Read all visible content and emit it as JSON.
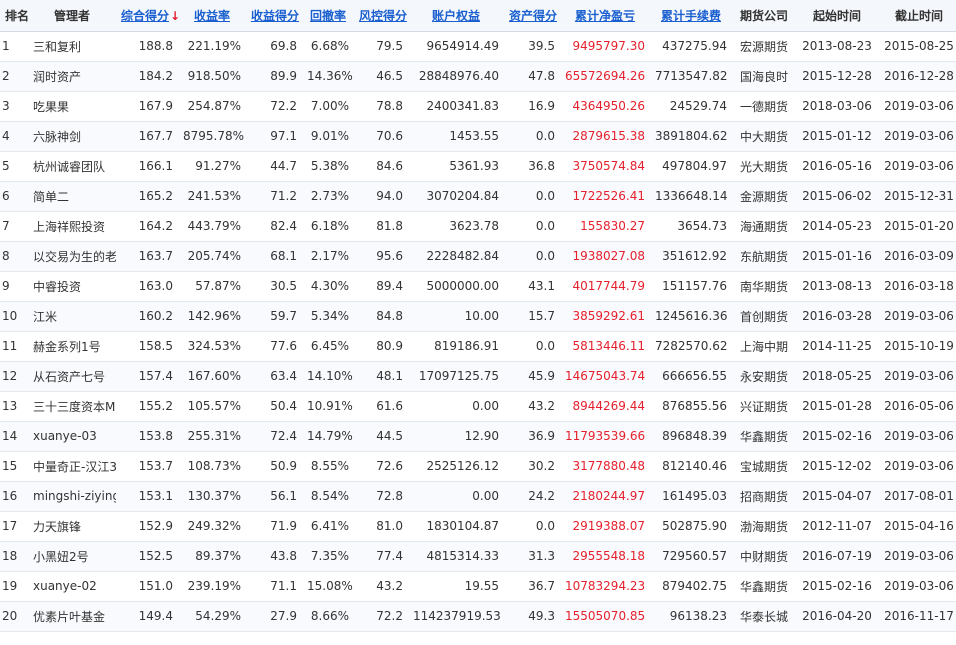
{
  "columns": [
    {
      "key": "rank",
      "label": "排名",
      "sortable": false
    },
    {
      "key": "manager",
      "label": "管理者",
      "sortable": false
    },
    {
      "key": "score",
      "label": "综合得分",
      "sortable": true,
      "sort_indicator": "↓"
    },
    {
      "key": "return_rate",
      "label": "收益率",
      "sortable": true
    },
    {
      "key": "return_score",
      "label": "收益得分",
      "sortable": true
    },
    {
      "key": "drawdown",
      "label": "回撤率",
      "sortable": true
    },
    {
      "key": "risk_score",
      "label": "风控得分",
      "sortable": true
    },
    {
      "key": "equity",
      "label": "账户权益",
      "sortable": true
    },
    {
      "key": "asset_score",
      "label": "资产得分",
      "sortable": true
    },
    {
      "key": "net_profit",
      "label": "累计净盈亏",
      "sortable": true
    },
    {
      "key": "fees",
      "label": "累计手续费",
      "sortable": true
    },
    {
      "key": "futures_co",
      "label": "期货公司",
      "sortable": false
    },
    {
      "key": "start",
      "label": "起始时间",
      "sortable": false
    },
    {
      "key": "end",
      "label": "截止时间",
      "sortable": false
    }
  ],
  "highlight_color": "#e5202d",
  "link_color": "#1a5fcf",
  "rows": [
    [
      "1",
      "三和复利",
      "188.8",
      "221.19%",
      "69.8",
      "6.68%",
      "79.5",
      "9654914.49",
      "39.5",
      "9495797.30",
      "437275.94",
      "宏源期货",
      "2013-08-23",
      "2015-08-25"
    ],
    [
      "2",
      "润时资产",
      "184.2",
      "918.50%",
      "89.9",
      "14.36%",
      "46.5",
      "28848976.40",
      "47.8",
      "65572694.26",
      "7713547.82",
      "国海良时",
      "2015-12-28",
      "2016-12-28"
    ],
    [
      "3",
      "吃果果",
      "167.9",
      "254.87%",
      "72.2",
      "7.00%",
      "78.8",
      "2400341.83",
      "16.9",
      "4364950.26",
      "24529.74",
      "一德期货",
      "2018-03-06",
      "2019-03-06"
    ],
    [
      "4",
      "六脉神剑",
      "167.7",
      "8795.78%",
      "97.1",
      "9.01%",
      "70.6",
      "1453.55",
      "0.0",
      "2879615.38",
      "3891804.62",
      "中大期货",
      "2015-01-12",
      "2019-03-06"
    ],
    [
      "5",
      "杭州诚睿团队",
      "166.1",
      "91.27%",
      "44.7",
      "5.38%",
      "84.6",
      "5361.93",
      "36.8",
      "3750574.84",
      "497804.97",
      "光大期货",
      "2016-05-16",
      "2019-03-06"
    ],
    [
      "6",
      "简单二",
      "165.2",
      "241.53%",
      "71.2",
      "2.73%",
      "94.0",
      "3070204.84",
      "0.0",
      "1722526.41",
      "1336648.14",
      "金源期货",
      "2015-06-02",
      "2015-12-31"
    ],
    [
      "7",
      "上海祥熙投资",
      "164.2",
      "443.79%",
      "82.4",
      "6.18%",
      "81.8",
      "3623.78",
      "0.0",
      "155830.27",
      "3654.73",
      "海通期货",
      "2014-05-23",
      "2015-01-20"
    ],
    [
      "8",
      "以交易为生的老",
      "163.7",
      "205.74%",
      "68.1",
      "2.17%",
      "95.6",
      "2228482.84",
      "0.0",
      "1938027.08",
      "351612.92",
      "东航期货",
      "2015-01-16",
      "2016-03-09"
    ],
    [
      "9",
      "中睿投资",
      "163.0",
      "57.87%",
      "30.5",
      "4.30%",
      "89.4",
      "5000000.00",
      "43.1",
      "4017744.79",
      "151157.76",
      "南华期货",
      "2013-08-13",
      "2016-03-18"
    ],
    [
      "10",
      "江米",
      "160.2",
      "142.96%",
      "59.7",
      "5.34%",
      "84.8",
      "10.00",
      "15.7",
      "3859292.61",
      "1245616.36",
      "首创期货",
      "2016-03-28",
      "2019-03-06"
    ],
    [
      "11",
      "赫金系列1号",
      "158.5",
      "324.53%",
      "77.6",
      "6.45%",
      "80.9",
      "819186.91",
      "0.0",
      "5813446.11",
      "7282570.62",
      "上海中期",
      "2014-11-25",
      "2015-10-19"
    ],
    [
      "12",
      "从石资产七号",
      "157.4",
      "167.60%",
      "63.4",
      "14.10%",
      "48.1",
      "17097125.75",
      "45.9",
      "14675043.74",
      "666656.55",
      "永安期货",
      "2018-05-25",
      "2019-03-06"
    ],
    [
      "13",
      "三十三度资本M",
      "155.2",
      "105.57%",
      "50.4",
      "10.91%",
      "61.6",
      "0.00",
      "43.2",
      "8944269.44",
      "876855.56",
      "兴证期货",
      "2015-01-28",
      "2016-05-06"
    ],
    [
      "14",
      "xuanye-03",
      "153.8",
      "255.31%",
      "72.4",
      "14.79%",
      "44.5",
      "12.90",
      "36.9",
      "11793539.66",
      "896848.39",
      "华鑫期货",
      "2015-02-16",
      "2019-03-06"
    ],
    [
      "15",
      "中量奇正-汉江3",
      "153.7",
      "108.73%",
      "50.9",
      "8.55%",
      "72.6",
      "2525126.12",
      "30.2",
      "3177880.48",
      "812140.46",
      "宝城期货",
      "2015-12-02",
      "2019-03-06"
    ],
    [
      "16",
      "mingshi-ziying",
      "153.1",
      "130.37%",
      "56.1",
      "8.54%",
      "72.8",
      "0.00",
      "24.2",
      "2180244.97",
      "161495.03",
      "招商期货",
      "2015-04-07",
      "2017-08-01"
    ],
    [
      "17",
      "力天旗锋",
      "152.9",
      "249.32%",
      "71.9",
      "6.41%",
      "81.0",
      "1830104.87",
      "0.0",
      "2919388.07",
      "502875.90",
      "渤海期货",
      "2012-11-07",
      "2015-04-16"
    ],
    [
      "18",
      "小黑妞2号",
      "152.5",
      "89.37%",
      "43.8",
      "7.35%",
      "77.4",
      "4815314.33",
      "31.3",
      "2955548.18",
      "729560.57",
      "中财期货",
      "2016-07-19",
      "2019-03-06"
    ],
    [
      "19",
      "xuanye-02",
      "151.0",
      "239.19%",
      "71.1",
      "15.08%",
      "43.2",
      "19.55",
      "36.7",
      "10783294.23",
      "879402.75",
      "华鑫期货",
      "2015-02-16",
      "2019-03-06"
    ],
    [
      "20",
      "优素片叶基金",
      "149.4",
      "54.29%",
      "27.9",
      "8.66%",
      "72.2",
      "114237919.53",
      "49.3",
      "15505070.85",
      "96138.23",
      "华泰长城",
      "2016-04-20",
      "2016-11-17"
    ]
  ]
}
